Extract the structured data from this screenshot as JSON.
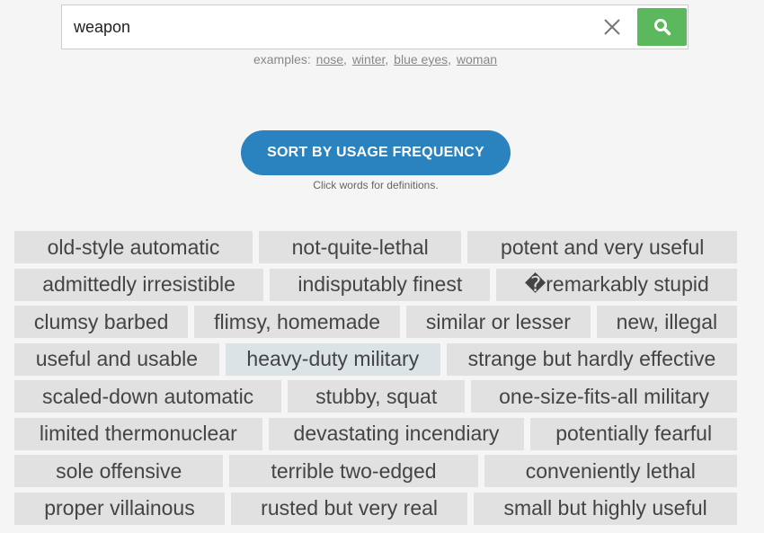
{
  "search": {
    "value": "weapon"
  },
  "examples": {
    "label": "examples:",
    "items": [
      "nose",
      "winter",
      "blue eyes",
      "woman"
    ]
  },
  "sort_button": {
    "label": "SORT BY USAGE FREQUENCY"
  },
  "hint": "Click words for definitions.",
  "icons": {
    "clear": "close-icon",
    "search": "search-icon"
  },
  "colors": {
    "search_button": "#5cb85c",
    "sort_button": "#2a83bf",
    "word_bg": "#e1e1e1",
    "word_highlight_bg": "#dbe3e7"
  },
  "word_rows": [
    [
      "old-style automatic",
      "not-quite-lethal",
      "potent and very useful"
    ],
    [
      "admittedly irresistible",
      "indisputably finest",
      "�remarkably stupid"
    ],
    [
      "clumsy barbed",
      "flimsy, homemade",
      "similar or lesser",
      "new, illegal"
    ],
    [
      "useful and usable",
      "heavy-duty military",
      "strange but hardly effective"
    ],
    [
      "scaled-down automatic",
      "stubby, squat",
      "one-size-fits-all military"
    ],
    [
      "limited thermonuclear",
      "devastating incendiary",
      "potentially fearful"
    ],
    [
      "sole offensive",
      "terrible two-edged",
      "conveniently lethal"
    ],
    [
      "proper villainous",
      "rusted but very real",
      "small but highly useful"
    ]
  ],
  "highlighted_word": "heavy-duty military"
}
